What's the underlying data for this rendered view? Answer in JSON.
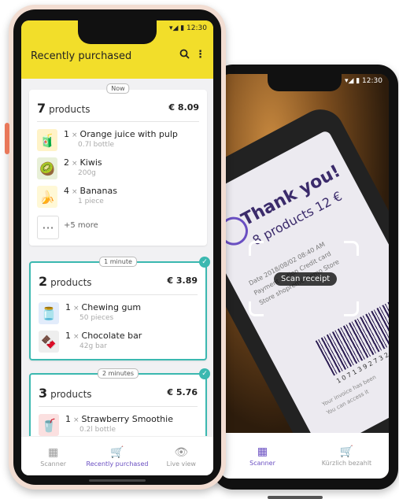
{
  "back_phone": {
    "status": "▾◢ ▮ 12:30",
    "receipt": {
      "thank_you": "Thank you!",
      "products": "8 products 12 €",
      "lines": [
        "Date       2018/08/02 08:40 AM",
        "Payment option   Credit card",
        "Store   shopreme Demo Store"
      ],
      "barcode_digits": "1 0 7 1 3 9 2 7 3 2 0 1",
      "footer": [
        "Your invoice has been",
        "You can access it"
      ]
    },
    "scan_label": "Scan receipt",
    "nav": [
      {
        "label": "Scanner",
        "icon": "barcode-icon",
        "active": true
      },
      {
        "label": "Kürzlich bezahlt",
        "icon": "cart-icon",
        "active": false
      }
    ]
  },
  "front_phone": {
    "status": "▾◢ ▮ 12:30",
    "title": "Recently purchased",
    "cards": [
      {
        "badge": "Now",
        "count": "7",
        "count_word": "products",
        "total": "€ 8.09",
        "items": [
          {
            "qty": "1",
            "name": "Orange juice with pulp",
            "sub": "0.7l bottle",
            "icon": "juice-bottle-icon"
          },
          {
            "qty": "2",
            "name": "Kiwis",
            "sub": "200g",
            "icon": "kiwi-icon"
          },
          {
            "qty": "4",
            "name": "Bananas",
            "sub": "1 piece",
            "icon": "banana-icon"
          }
        ],
        "more": "+5 more"
      },
      {
        "badge": "1 minute",
        "count": "2",
        "count_word": "products",
        "total": "€ 3.89",
        "items": [
          {
            "qty": "1",
            "name": "Chewing gum",
            "sub": "50 pieces",
            "icon": "gum-jar-icon"
          },
          {
            "qty": "1",
            "name": "Chocolate bar",
            "sub": "42g bar",
            "icon": "chocolate-bar-icon"
          }
        ]
      },
      {
        "badge": "2 minutes",
        "count": "3",
        "count_word": "products",
        "total": "€ 5.76",
        "items": [
          {
            "qty": "1",
            "name": "Strawberry Smoothie",
            "sub": "0.2l bottle",
            "icon": "smoothie-bottle-icon"
          }
        ]
      }
    ],
    "nav": [
      {
        "label": "Scanner",
        "icon": "barcode-icon",
        "active": false
      },
      {
        "label": "Recently purchased",
        "icon": "cart-icon",
        "active": true
      },
      {
        "label": "Live view",
        "icon": "eye-icon",
        "active": false
      }
    ]
  },
  "colors": {
    "appbar": "#f2de2a",
    "accent": "#6a4fc2",
    "highlight": "#3bb8b0"
  }
}
